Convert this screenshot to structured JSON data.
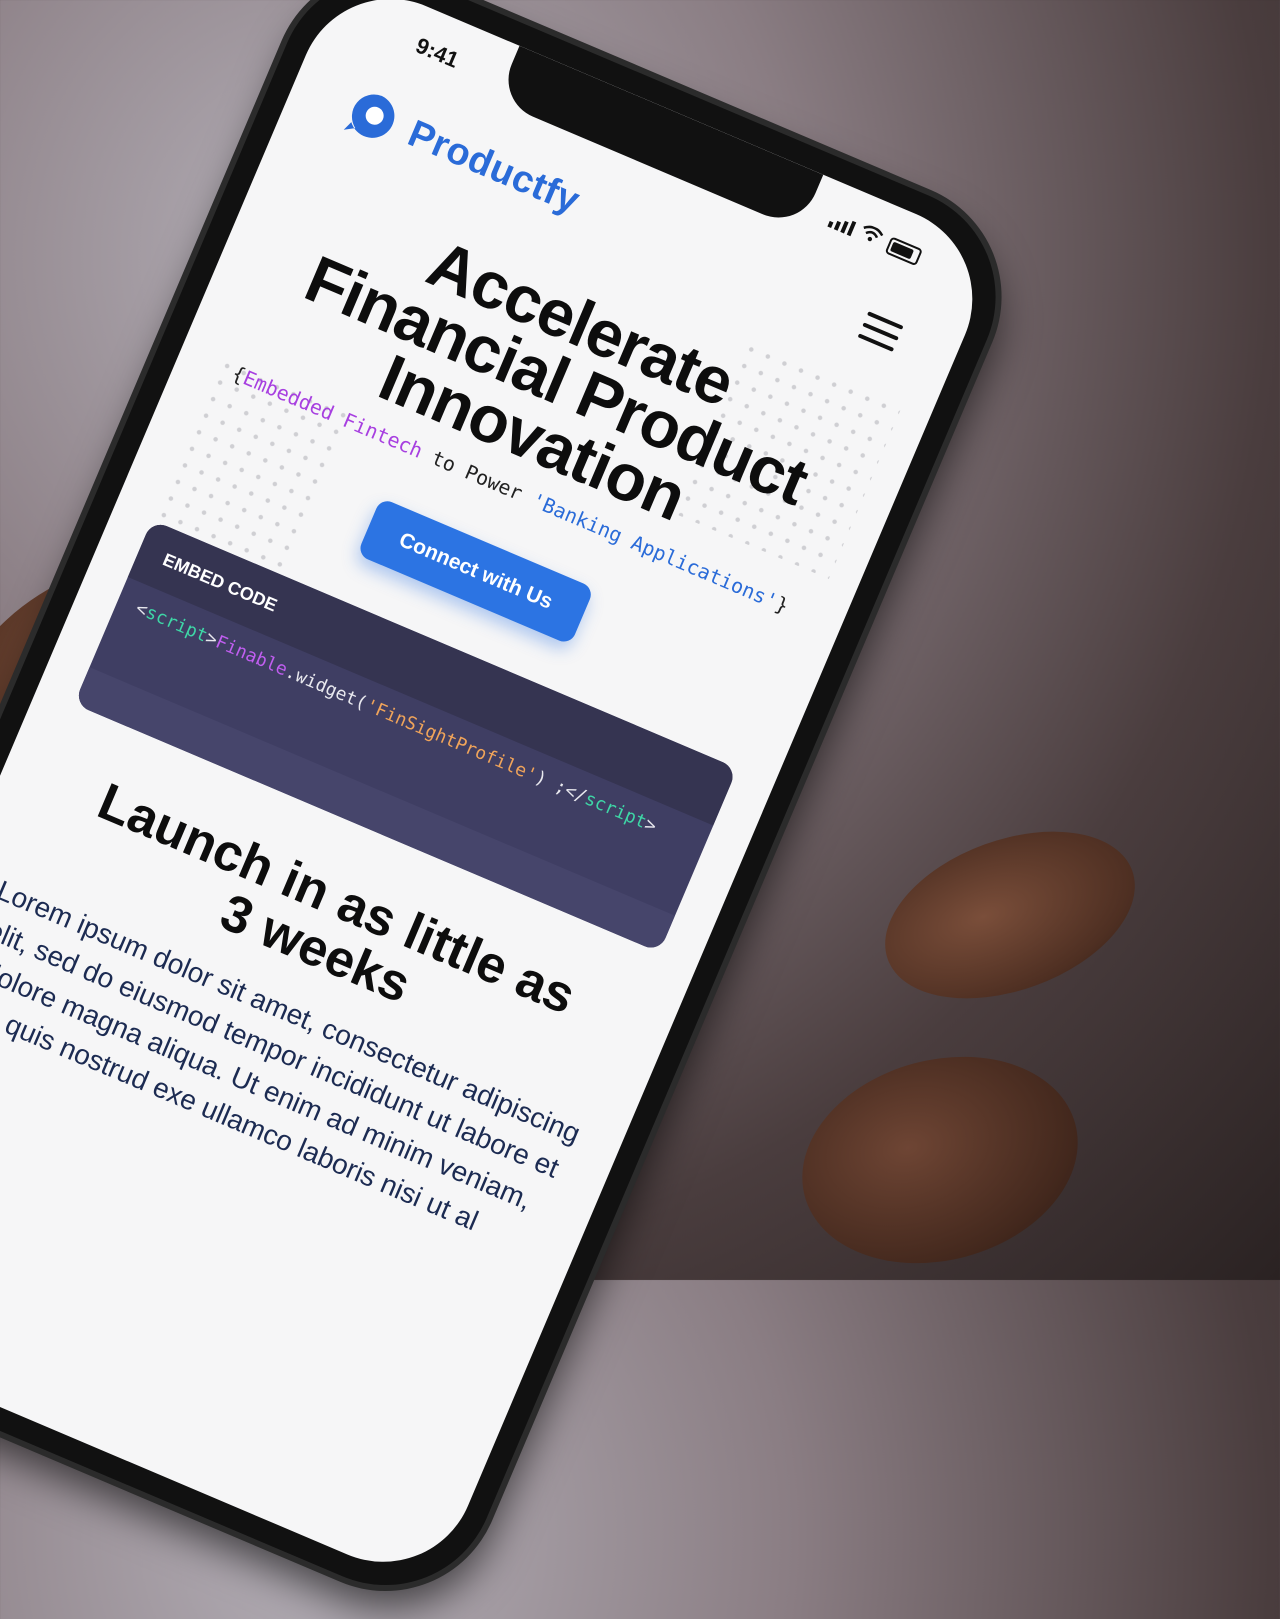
{
  "status_bar": {
    "time": "9:41"
  },
  "brand": {
    "name": "Productfy",
    "color": "#2a6bd8"
  },
  "menu": {
    "icon": "hamburger-menu-icon"
  },
  "hero": {
    "title": "Accelerate\nFinancial Product\nInnovation",
    "tagline": {
      "open": "{",
      "part1": "Embedded Fintech",
      "middle": " to Power ",
      "part2": "'Banking Applications'",
      "close": "}"
    },
    "cta_label": "Connect with Us",
    "cta_color": "#2c74e3"
  },
  "embed": {
    "header": "EMBED CODE",
    "code": {
      "open_lt": "<",
      "open_tag": "script",
      "open_gt": ">",
      "obj": "Finable",
      "method": ".widget(",
      "arg": "'FinSightProfile'",
      "tail": ") ;</",
      "close_tag": "script",
      "close_gt": ">"
    }
  },
  "section": {
    "title": "Launch in as little as\n3 weeks",
    "body": "Lorem ipsum dolor sit amet, consectetur adipiscing elit, sed do eiusmod tempor incididunt ut labore et dolore magna aliqua. Ut enim ad minim veniam, quis nostrud exe ullamco laboris nisi ut al"
  }
}
